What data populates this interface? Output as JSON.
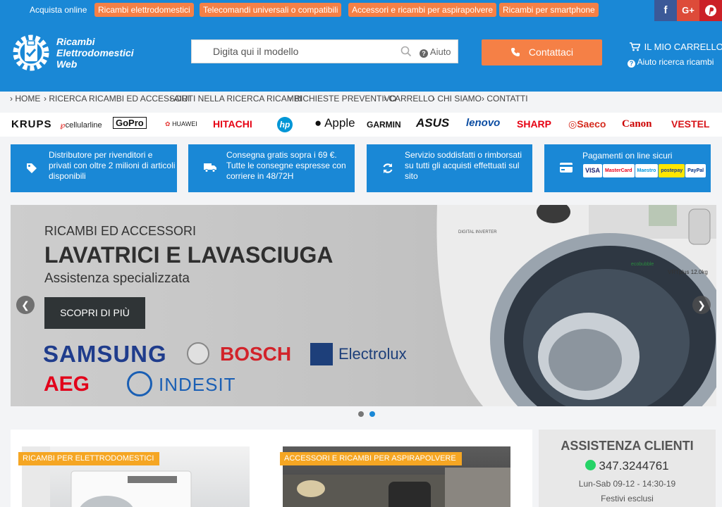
{
  "topbar": {
    "label": "Acquista online",
    "pills": [
      "Ricambi elettrodomestici",
      "Telecomandi universali o compatibili",
      "Accessori e ricambi per aspirapolvere",
      "Ricambi per smartphone"
    ],
    "social": [
      {
        "icon": "f",
        "color": "#3b5998"
      },
      {
        "icon": "G+",
        "color": "#dd4b39"
      },
      {
        "icon": "P",
        "color": "#cb2027"
      }
    ]
  },
  "header": {
    "logo_lines": [
      "Ricambi",
      "Elettrodomestici",
      "Web"
    ],
    "search_placeholder": "Digita qui il modello",
    "search_help": "Aiuto",
    "contact_label": "Contattaci",
    "cart_label": "IL MIO CARRELLO",
    "help_label": "Aiuto ricerca ricambi"
  },
  "nav": [
    "HOME",
    "RICERCA RICAMBI ED ACCESSORI",
    "AIUTI NELLA RICERCA RICAMBI",
    "RICHIESTE PREVENTIVO",
    "CARRELLO",
    "CHI SIAMO",
    "CONTATTI"
  ],
  "brands": [
    "KRUPS",
    "cellularline",
    "GoPro",
    "HUAWEI",
    "HITACHI",
    "hp",
    "Apple",
    "GARMIN",
    "ASUS",
    "lenovo",
    "SHARP",
    "Saeco",
    "Canon",
    "VESTEL"
  ],
  "features": [
    {
      "icon": "tag-icon",
      "text": "Distributore per rivenditori e privati con oltre 2 milioni di articoli disponibili"
    },
    {
      "icon": "truck-icon",
      "text": "Consegna gratis sopra i 69 €. Tutte le consegne espresse con corriere in 48/72H"
    },
    {
      "icon": "refresh-icon",
      "text": "Servizio soddisfatti o rimborsati su tutti gli acquisti effettuati sul sito"
    },
    {
      "icon": "credit-card-icon",
      "text": "Pagamenti on line sicuri",
      "cards": [
        "VISA",
        "MasterCard",
        "Maestro",
        "postepay",
        "PayPal"
      ]
    }
  ],
  "slider": {
    "line1": "RICAMBI ED ACCESSORI",
    "line2": "LAVATRICI E LAVASCIUGA",
    "line3": "Assistenza specializzata",
    "button": "SCOPRI DI PIÙ",
    "brands": [
      "SAMSUNG",
      "BOSCH",
      "Electrolux",
      "AEG",
      "INDESIT"
    ],
    "machine_labels": [
      "DIGITAL INVERTER",
      "ecobubble",
      "VRTplus 12.0kg"
    ],
    "active_slide": 2
  },
  "categories": [
    "RICAMBI PER ELETTRODOMESTICI",
    "ACCESSORI E RICAMBI PER ASPIRAPOLVERE"
  ],
  "assistance": {
    "title": "ASSISTENZA CLIENTI",
    "phone": "347.3244761",
    "hours": "Lun-Sab 09-12 - 14:30-19",
    "note": "Festivi esclusi"
  },
  "colors": {
    "primary": "#1a88d6",
    "accent": "#f58046",
    "tag": "#f5a623"
  }
}
